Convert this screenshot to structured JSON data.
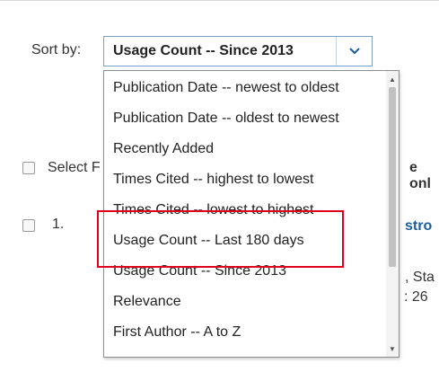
{
  "sort": {
    "label": "Sort by:",
    "selected_value": "Usage Count -- Since 2013",
    "button_icon": "chevron-down-icon"
  },
  "background": {
    "select_partial": "Select F",
    "toolbar_partial": "e onl",
    "result_number": "1.",
    "title_partial": "stro",
    "meta_partial_1": ", Sta",
    "meta_partial_2": ": 26"
  },
  "dropdown": {
    "options": [
      "Publication Date -- newest to oldest",
      "Publication Date -- oldest to newest",
      "Recently Added",
      "Times Cited -- highest to lowest",
      "Times Cited -- lowest to highest",
      "Usage Count -- Last 180 days",
      "Usage Count -- Since 2013",
      "Relevance",
      "First Author -- A to Z"
    ],
    "scroll_up_icon": "▲",
    "scroll_down_icon": "▼"
  },
  "colors": {
    "highlight": "#e0001b",
    "link_blue": "#1b5e9f",
    "select_border": "#7aa3c9"
  }
}
